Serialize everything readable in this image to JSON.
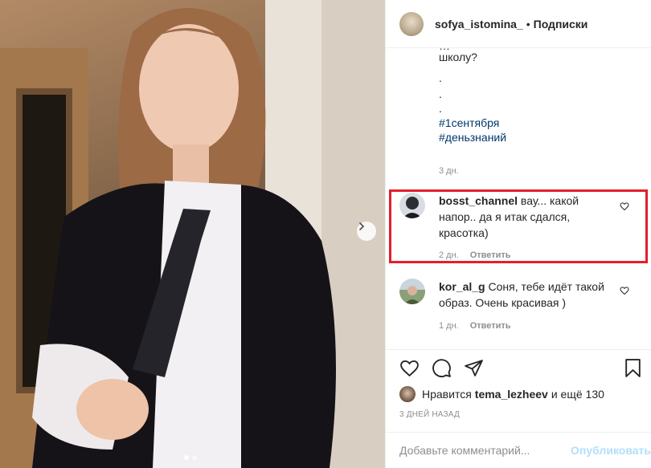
{
  "post": {
    "username": "sofya_istomina_",
    "separator": "•",
    "follow_label": "Подписки",
    "caption_cut": "…",
    "caption_lines": [
      "школу?",
      ".",
      ".",
      "."
    ],
    "hashtags": [
      "#1сентября",
      "#деньзнаний"
    ],
    "caption_time": "3 дн."
  },
  "comments": [
    {
      "username": "bosst_channel",
      "text": "вау... какой напор.. да я итак сдался, красотка)",
      "time": "2 дн.",
      "reply_label": "Ответить",
      "highlighted": true
    },
    {
      "username": "kor_al_g",
      "text": "Соня, тебе идёт такой образ. Очень красивая )",
      "time": "1 дн.",
      "reply_label": "Ответить",
      "highlighted": false
    }
  ],
  "likes": {
    "prefix": "Нравится",
    "user": "tema_lezheev",
    "suffix": "и ещё 130"
  },
  "date_label": "3 ДНЕЙ НАЗАД",
  "comment_input": {
    "placeholder": "Добавьте комментарий...",
    "publish_label": "Опубликовать"
  },
  "carousel": {
    "slide_count": 2,
    "active_index": 0
  },
  "icons": [
    "heart-icon",
    "comment-icon",
    "share-icon",
    "bookmark-icon",
    "chevron-right-icon"
  ],
  "colors": {
    "highlight": "#e41e2a",
    "link": "#00376b",
    "publish_disabled": "#b2dffc"
  }
}
